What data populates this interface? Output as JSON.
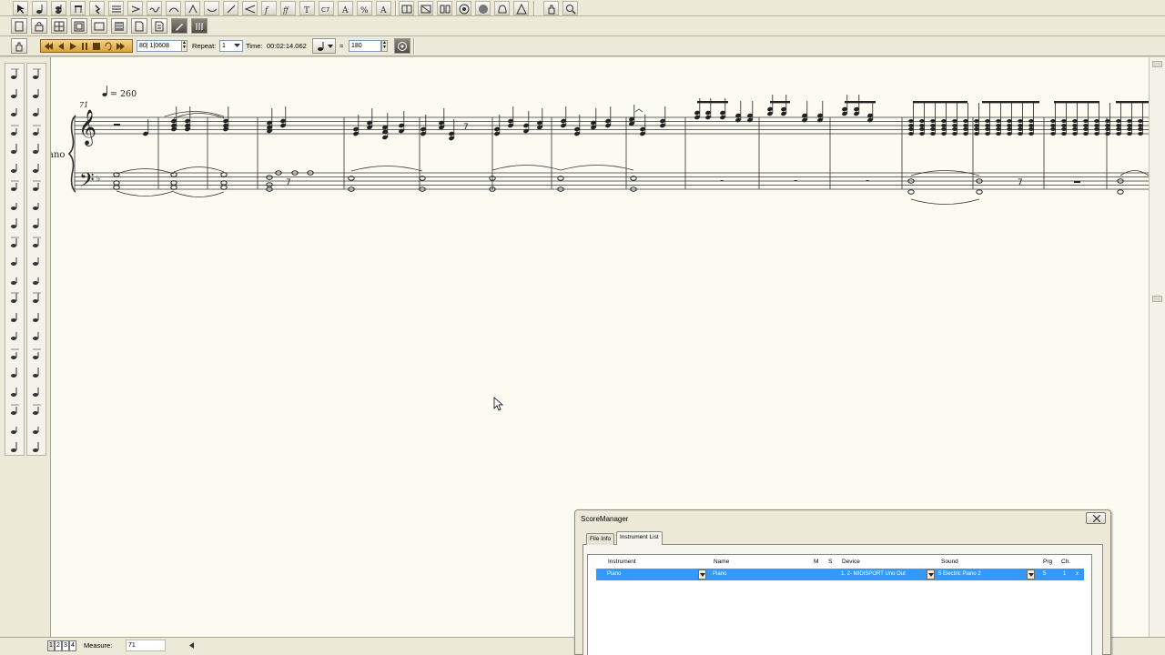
{
  "toolbar": {
    "play_section": {
      "position": "80| 1|0608",
      "repeat_label": "Repeat:",
      "repeat_value": "1",
      "time_label": "Time:",
      "time_value": "00:02:14.062",
      "tempo_eq": "=",
      "tempo_value": "180"
    }
  },
  "score": {
    "measure_number": "71",
    "tempo_marking": "= 260",
    "instrument_label": "ano",
    "rest_measures": [
      "-",
      "-",
      "-"
    ],
    "triplet_rests": [
      "7",
      "7",
      "7"
    ]
  },
  "status_bar": {
    "pages": [
      "1",
      "2",
      "3",
      "4"
    ],
    "measure_label": "Measure:",
    "measure_value": "71"
  },
  "score_manager": {
    "title": "ScoreManager",
    "tabs": [
      "File Info",
      "Instrument List"
    ],
    "columns": {
      "instrument": "Instrument",
      "name": "Name",
      "m": "M",
      "s": "S",
      "device": "Device",
      "sound": "Sound",
      "prg": "Prg",
      "ch": "Ch."
    },
    "row": {
      "instrument": "Piano",
      "name": "Piano",
      "device": "1. 2- MIDISPORT Uno Out",
      "sound": "5 Electric Piano 2",
      "prg": "5",
      "ch": "1",
      "x": "x"
    }
  },
  "colors": {
    "selection": "#3399ff",
    "transport": "#e2ac4a",
    "paper": "#fbfbf2",
    "chrome": "#ece9d8"
  }
}
